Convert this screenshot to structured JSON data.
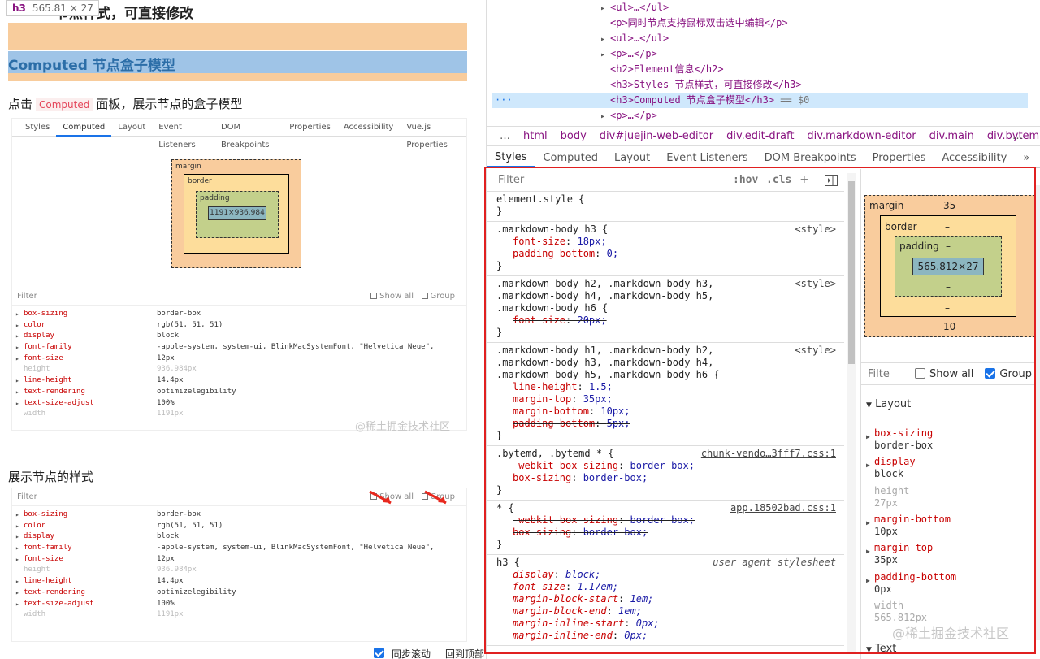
{
  "left": {
    "tooltip": {
      "tag": "h3",
      "size": "565.81 × 27"
    },
    "heading_top": "节点样式，可直接修改",
    "heading_highlight": "Computed 节点盒子模型",
    "para1": {
      "before": "点击",
      "code": "Computed",
      "after": "面板，展示节点的盒子模型"
    },
    "shot1": {
      "tabs": [
        "Styles",
        "Computed",
        "Layout",
        "Event Listeners",
        "DOM Breakpoints",
        "Properties",
        "Accessibility",
        "Vue.js Properties"
      ],
      "box": {
        "margin": "margin",
        "border": "border",
        "padding": "padding",
        "content": "1191×936.984",
        "dash": "–"
      },
      "filter": "Filter",
      "show_all": "Show all",
      "group": "Group",
      "props": [
        {
          "p": "box-sizing",
          "v": "border-box"
        },
        {
          "p": "color",
          "v": "rgb(51, 51, 51)"
        },
        {
          "p": "display",
          "v": "block"
        },
        {
          "p": "font-family",
          "v": "-apple-system, system-ui, BlinkMacSystemFont, \"Helvetica Neue\","
        },
        {
          "p": "font-size",
          "v": "12px"
        },
        {
          "p": "height",
          "v": "936.984px",
          "dim": true
        },
        {
          "p": "line-height",
          "v": "14.4px"
        },
        {
          "p": "text-rendering",
          "v": "optimizelegibility"
        },
        {
          "p": "text-size-adjust",
          "v": "100%"
        },
        {
          "p": "width",
          "v": "1191px",
          "dim": true
        }
      ]
    },
    "watermark": "@稀土掘金技术社区",
    "para2": "展示节点的样式",
    "shot2": {
      "filter": "Filter",
      "show_all": "Show all",
      "group": "Group",
      "props": [
        {
          "p": "box-sizing",
          "v": "border-box"
        },
        {
          "p": "color",
          "v": "rgb(51, 51, 51)"
        },
        {
          "p": "display",
          "v": "block"
        },
        {
          "p": "font-family",
          "v": "-apple-system, system-ui, BlinkMacSystemFont, \"Helvetica Neue\","
        },
        {
          "p": "font-size",
          "v": "12px"
        },
        {
          "p": "height",
          "v": "936.984px",
          "dim": true
        },
        {
          "p": "line-height",
          "v": "14.4px"
        },
        {
          "p": "text-rendering",
          "v": "optimizelegibility"
        },
        {
          "p": "text-size-adjust",
          "v": "100%"
        },
        {
          "p": "width",
          "v": "1191px",
          "dim": true
        }
      ]
    },
    "bottom": {
      "sync": "同步滚动",
      "top": "回到顶部"
    }
  },
  "dom": {
    "lines": [
      {
        "pre": "▸",
        "html": "<ul>…</ul>"
      },
      {
        "pre": "",
        "html": "<p>同时节点支持鼠标双击选中编辑</p>"
      },
      {
        "pre": "▸",
        "html": "<ul>…</ul>"
      },
      {
        "pre": "▸",
        "html": "<p>…</p>"
      },
      {
        "pre": "",
        "html": "<h2>Element信息</h2>"
      },
      {
        "pre": "",
        "html": "<h3>Styles 节点样式，可直接修改</h3>"
      },
      {
        "pre": "",
        "html": "<h3>Computed 节点盒子模型</h3>",
        "selected": true,
        "suffix": " == $0"
      },
      {
        "pre": "▸",
        "html": "<p>…</p>"
      }
    ],
    "dots": "···"
  },
  "breadcrumbs": [
    "…",
    "html",
    "body",
    "div#juejin-web-editor",
    "div.edit-draft",
    "div.markdown-editor",
    "div.main",
    "div.bytemd.byt"
  ],
  "breadcrumb_more": "…",
  "panel_tabs": [
    "Styles",
    "Computed",
    "Layout",
    "Event Listeners",
    "DOM Breakpoints",
    "Properties",
    "Accessibility"
  ],
  "panel_tab_more": "»",
  "styles": {
    "filter_placeholder": "Filter",
    "hov": ":hov",
    "cls": ".cls",
    "plus": "+",
    "rules": [
      {
        "selector": "element.style {",
        "source": "",
        "decls": [],
        "close": "}"
      },
      {
        "selector": ".markdown-body h3 {",
        "source": "<style>",
        "decls": [
          {
            "n": "font-size",
            "v": "18px;"
          },
          {
            "n": "padding-bottom",
            "v": "0;"
          }
        ],
        "close": "}"
      },
      {
        "selector": ".markdown-body h2, .markdown-body h3, .markdown-body h4, .markdown-body h5, .markdown-body h6 {",
        "source": "<style>",
        "decls": [
          {
            "n": "font-size",
            "v": "20px;",
            "strike": true
          }
        ],
        "close": "}"
      },
      {
        "selector": ".markdown-body h1, .markdown-body h2, .markdown-body h3, .markdown-body h4, .markdown-body h5, .markdown-body h6 {",
        "source": "<style>",
        "decls": [
          {
            "n": "line-height",
            "v": "1.5;"
          },
          {
            "n": "margin-top",
            "v": "35px;"
          },
          {
            "n": "margin-bottom",
            "v": "10px;"
          },
          {
            "n": "padding-bottom",
            "v": "5px;",
            "strike": true
          }
        ],
        "close": "}"
      },
      {
        "selector": ".bytemd, .bytemd * {",
        "source": "chunk-vendo…3fff7.css:1",
        "link": true,
        "decls": [
          {
            "n": "-webkit-box-sizing",
            "v": "border-box;",
            "strike": true
          },
          {
            "n": "box-sizing",
            "v": "border-box;"
          }
        ],
        "close": "}"
      },
      {
        "selector": "* {",
        "source": "app.18502bad.css:1",
        "link": true,
        "decls": [
          {
            "n": "-webkit-box-sizing",
            "v": "border-box;",
            "strike": true
          },
          {
            "n": "box-sizing",
            "v": "border-box;",
            "strike": true
          }
        ],
        "close": "}"
      },
      {
        "selector": "h3 {",
        "source": "user agent stylesheet",
        "italic": true,
        "decls": [
          {
            "n": "display",
            "v": "block;"
          },
          {
            "n": "font-size",
            "v": "1.17em;",
            "strike": true
          },
          {
            "n": "margin-block-start",
            "v": "1em;"
          },
          {
            "n": "margin-block-end",
            "v": "1em;"
          },
          {
            "n": "margin-inline-start",
            "v": "0px;"
          },
          {
            "n": "margin-inline-end",
            "v": "0px;"
          }
        ],
        "close": ""
      }
    ]
  },
  "computed": {
    "margin_label": "margin",
    "margin_top": "35",
    "margin_bottom": "10",
    "margin_side": "–",
    "border_label": "border",
    "border_val": "–",
    "padding_label": "padding",
    "padding_val": "–",
    "content": "565.812×27",
    "filter": "Filte",
    "show_all": "Show all",
    "group": "Group",
    "section": "Layout",
    "props": [
      {
        "n": "box-sizing",
        "v": "border-box"
      },
      {
        "n": "display",
        "v": "block"
      },
      {
        "n": "height",
        "v": "27px",
        "dim": true
      },
      {
        "n": "margin-bottom",
        "v": "10px"
      },
      {
        "n": "margin-top",
        "v": "35px"
      },
      {
        "n": "padding-bottom",
        "v": "0px"
      },
      {
        "n": "width",
        "v": "565.812px",
        "dim": true
      }
    ],
    "section2": "Text",
    "watermark": "@稀土掘金技术社区"
  },
  "colors": {
    "accent": "#1a73e8",
    "highlight_box": "#e02020",
    "tag": "#881280",
    "prop": "#c80000"
  }
}
